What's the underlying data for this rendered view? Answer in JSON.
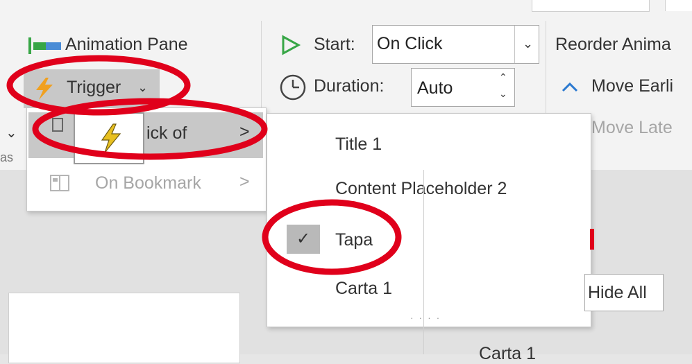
{
  "ribbon": {
    "animation_pane": "Animation Pane",
    "trigger": "Trigger",
    "start_label": "Start:",
    "start_value": "On Click",
    "duration_label": "Duration:",
    "duration_value": "Auto",
    "reorder_header": "Reorder Anima",
    "move_earlier": "Move Earli",
    "move_later": "Move Late"
  },
  "trigger_menu": {
    "items": [
      {
        "label": "On Click of",
        "visible_label": "ick of",
        "arrow": ">"
      },
      {
        "label": "On Bookmark",
        "arrow": ">"
      }
    ]
  },
  "submenu": {
    "items": [
      {
        "label": "Title 1",
        "checked": false
      },
      {
        "label": "Content Placeholder 2",
        "checked": false
      },
      {
        "label": "Tapa",
        "checked": true
      },
      {
        "label": "Carta 1",
        "checked": false
      }
    ],
    "resize_grip": "· · · ·"
  },
  "pane": {
    "hide_all": "Hide All",
    "item_peek": "Carta 1"
  },
  "colors": {
    "annotation": "#e0001b",
    "trigger_icon": "#f0a020",
    "lightning_icon": "#e8c020",
    "play_icon": "#37a646",
    "arrow_icon": "#2b79d0",
    "animation_icon": "#37a646",
    "check_bg": "#b9b9b9"
  }
}
